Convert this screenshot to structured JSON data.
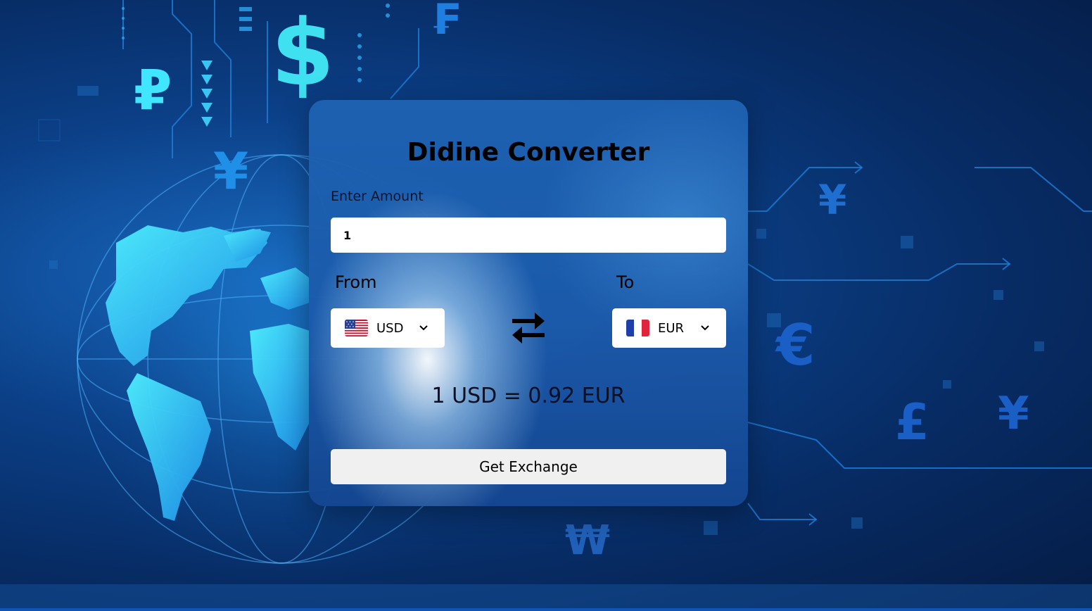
{
  "app": {
    "title": "Didine Converter"
  },
  "amount": {
    "label": "Enter Amount",
    "value": "1"
  },
  "from": {
    "label": "From",
    "currency": "USD",
    "flag_icon": "us-flag-icon"
  },
  "to": {
    "label": "To",
    "currency": "EUR",
    "flag_icon": "fr-flag-icon"
  },
  "swap_icon": "swap-arrows-icon",
  "result_text": "1 USD = 0.92 EUR",
  "exchange_button": {
    "label": "Get Exchange"
  },
  "background_symbols": [
    "₽",
    "$",
    "₣",
    "¥",
    "¥",
    "€",
    "£",
    "¥",
    "₩"
  ],
  "colors": {
    "card_bg": "#1e62b2",
    "background_dark": "#072b63",
    "accent_glow": "#38e0ff",
    "button_bg": "#f0f0f0"
  }
}
